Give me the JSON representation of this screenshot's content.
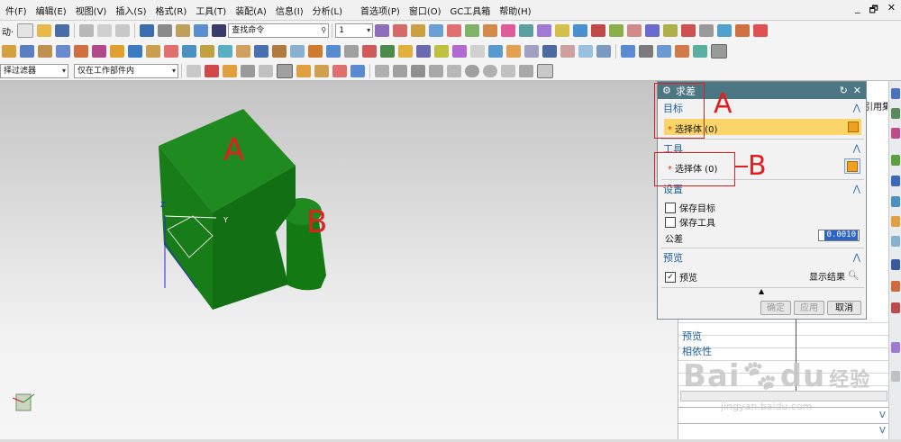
{
  "menubar": {
    "items": [
      "件(F)",
      "编辑(E)",
      "视图(V)",
      "插入(S)",
      "格式(R)",
      "工具(T)",
      "装配(A)",
      "信息(I)",
      "分析(L)",
      "首选项(P)",
      "窗口(O)",
      "GC工具箱",
      "帮助(H)"
    ],
    "window_controls": [
      "_",
      "🗗",
      "✕"
    ]
  },
  "toolbar1": {
    "start_label": "动·",
    "command_search": "查找命令",
    "layer_value": "1"
  },
  "toolbar3": {
    "filter_value": "择过滤器",
    "scope_value": "仅在工作部件内"
  },
  "dialog": {
    "title": "求差",
    "sections": {
      "target": {
        "title": "目标",
        "select_label": "选择体 (0)"
      },
      "tool": {
        "title": "工具",
        "select_label": "选择体 (0)"
      },
      "settings": {
        "title": "设置",
        "keep_target": "保存目标",
        "keep_tool": "保存工具",
        "tolerance_label": "公差",
        "tolerance_value": "0.0010"
      },
      "preview": {
        "title": "预览",
        "preview_label": "预览",
        "show_result": "显示结果"
      }
    },
    "buttons": {
      "ok": "确定",
      "apply": "应用",
      "cancel": "取消"
    }
  },
  "right_panel": {
    "header_fragment": "引用集",
    "bottom_sections": [
      "预览",
      "相依性"
    ]
  },
  "annotations": {
    "label_a": "A",
    "label_b": "B"
  },
  "watermark": {
    "brand": "Bai",
    "brand2": "du",
    "cn": "经验",
    "url": "jingyan.baidu.com"
  },
  "axis": {
    "y": "Y",
    "z": "Z"
  },
  "colors": {
    "solid_green": "#1f8a1f",
    "dialog_title": "#4d7683",
    "highlight": "#fbd56a",
    "annotation_red": "#e02020"
  }
}
